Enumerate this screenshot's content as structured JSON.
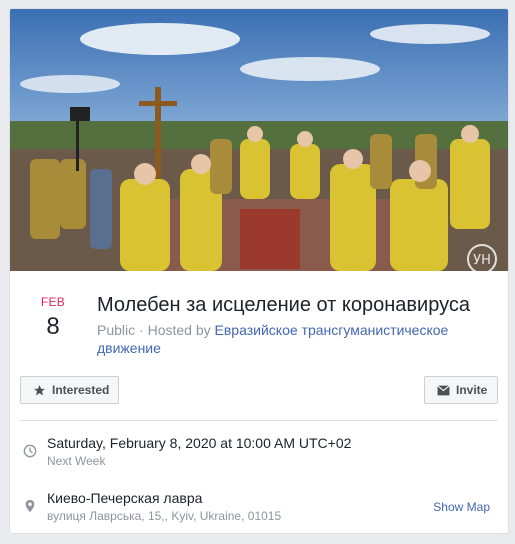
{
  "event": {
    "month": "FEB",
    "day": "8",
    "title": "Молебен за исцеление от коронавируса",
    "privacy": "Public",
    "separator": " · ",
    "hosted_by_label": "Hosted by ",
    "host": "Евразийское трансгуманистическое движение"
  },
  "actions": {
    "interested_label": "Interested",
    "invite_label": "Invite"
  },
  "time": {
    "main": "Saturday, February 8, 2020 at 10:00 AM UTC+02",
    "sub": "Next Week"
  },
  "location": {
    "name": "Киево-Печерская лавра",
    "address": "вулиця Лаврська, 15,, Kyiv, Ukraine, 01015",
    "show_map_label": "Show Map"
  },
  "colors": {
    "month": "#e0245e",
    "link": "#4267b2",
    "muted": "#90949c"
  },
  "icons": {
    "interested": "star-icon",
    "invite": "envelope-icon",
    "time": "clock-icon",
    "location": "pin-icon",
    "watermark": "channel-logo-icon"
  }
}
